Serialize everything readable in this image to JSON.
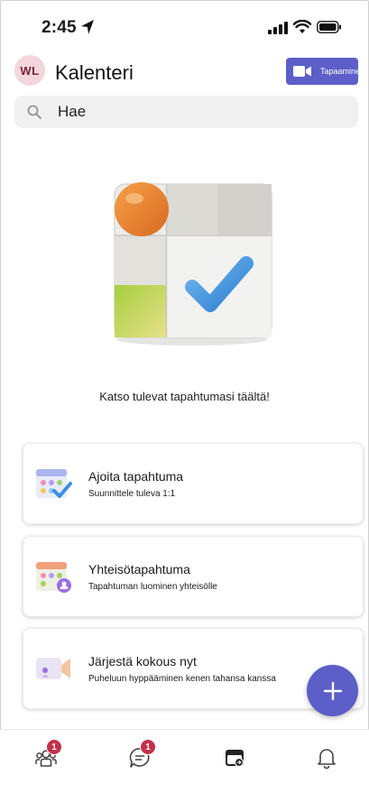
{
  "status_bar": {
    "time": "2:45"
  },
  "header": {
    "avatar_initials": "WL",
    "title": "Kalenteri",
    "meet_button_label": "Tapaaminen"
  },
  "search": {
    "placeholder": "Hae"
  },
  "empty_state": {
    "message": "Katso tulevat tapahtumasi täältä!"
  },
  "cards": [
    {
      "title": "Ajoita tapahtuma",
      "subtitle": "Suunnittele tuleva 1:1",
      "icon": "calendar-check-icon"
    },
    {
      "title": "Yhteisötapahtuma",
      "subtitle": "Tapahtuman luominen yhteisölle",
      "icon": "community-calendar-icon"
    },
    {
      "title": "Järjestä kokous nyt",
      "subtitle": "Puheluun hyppääminen kenen tahansa kanssa",
      "icon": "video-call-icon"
    }
  ],
  "bottom_nav": [
    {
      "name": "communities",
      "badge": "1",
      "icon": "people-icon"
    },
    {
      "name": "chat",
      "badge": "1",
      "icon": "chat-icon"
    },
    {
      "name": "calendar",
      "badge": "",
      "icon": "calendar-icon"
    },
    {
      "name": "activity",
      "badge": "",
      "icon": "bell-icon"
    }
  ],
  "colors": {
    "accent": "#5b5fc7",
    "badge": "#c4314b",
    "avatar_bg": "#f3d6dd"
  }
}
